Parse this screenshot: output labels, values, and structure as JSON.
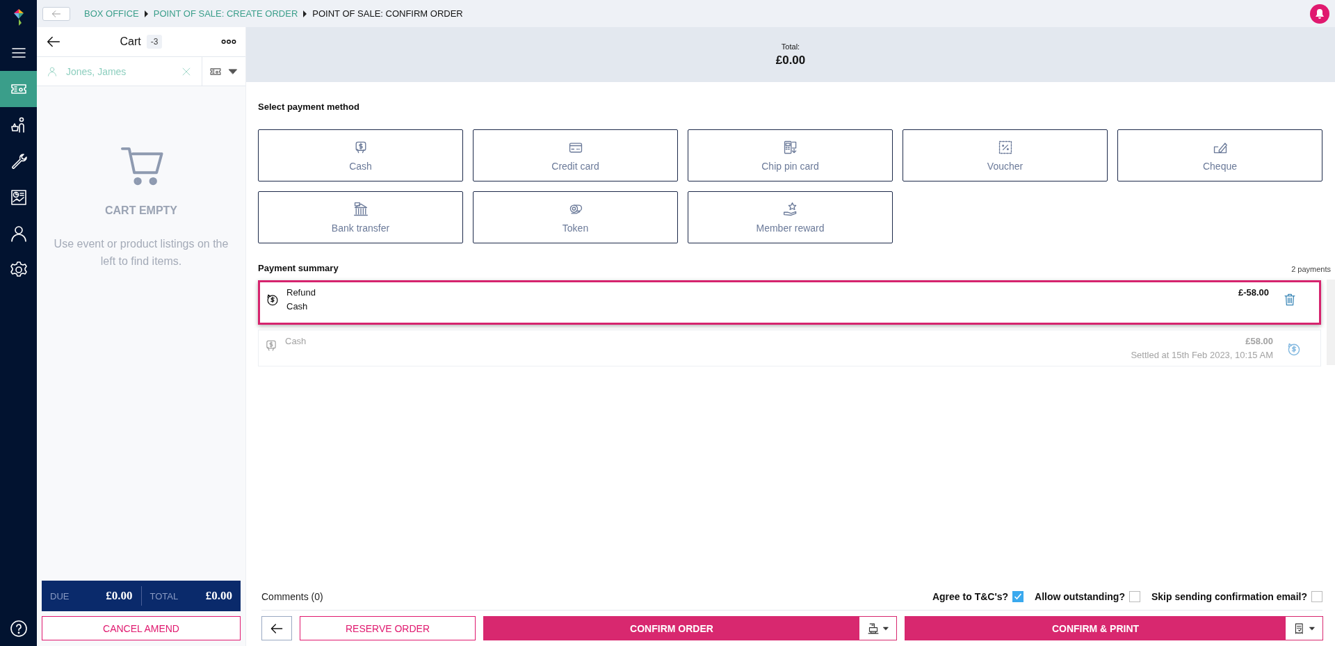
{
  "nav": {
    "items": [
      {
        "kind": "menu",
        "selected": false
      },
      {
        "kind": "ticket",
        "selected": true
      },
      {
        "kind": "basket",
        "selected": false
      },
      {
        "kind": "wrench",
        "selected": false
      },
      {
        "kind": "report",
        "selected": false
      },
      {
        "kind": "person",
        "selected": false
      },
      {
        "kind": "gear",
        "selected": false
      }
    ]
  },
  "breadcrumb": {
    "items": [
      {
        "label": "BOX OFFICE",
        "current": false
      },
      {
        "label": "POINT OF SALE: CREATE ORDER",
        "current": false
      },
      {
        "label": "POINT OF SALE: CONFIRM ORDER",
        "current": true
      }
    ]
  },
  "cart": {
    "title": "Cart",
    "count": "-3",
    "customer": "Jones, James",
    "empty_title": "CART EMPTY",
    "empty_text": "Use event or product listings on the left to find items.",
    "due_label": "DUE",
    "due_value": "£0.00",
    "total_label": "TOTAL",
    "total_value": "£0.00",
    "cancel_button": "CANCEL AMEND"
  },
  "total": {
    "label": "Total:",
    "value": "£0.00"
  },
  "payment_methods": {
    "heading": "Select payment method",
    "items": [
      {
        "label": "Cash",
        "kind": "cash"
      },
      {
        "label": "Credit card",
        "kind": "card"
      },
      {
        "label": "Chip pin card",
        "kind": "chip"
      },
      {
        "label": "Voucher",
        "kind": "voucher"
      },
      {
        "label": "Cheque",
        "kind": "cheque"
      },
      {
        "label": "Bank transfer",
        "kind": "bank"
      },
      {
        "label": "Token",
        "kind": "token"
      },
      {
        "label": "Member reward",
        "kind": "reward"
      }
    ]
  },
  "payment_summary": {
    "heading": "Payment summary",
    "count": "2 payments",
    "payments": [
      {
        "kind": "refund",
        "selected": true,
        "title": "Refund",
        "method": "Cash",
        "amount": "£-58.00"
      },
      {
        "kind": "payment",
        "selected": false,
        "method": "Cash",
        "amount": "£58.00",
        "settled": "Settled at 15th Feb 2023, 10:15 AM"
      }
    ]
  },
  "footer": {
    "comments": "Comments (0)",
    "options": [
      {
        "label": "Agree to T&C's?",
        "checked": true
      },
      {
        "label": "Allow outstanding?",
        "checked": false
      },
      {
        "label": "Skip sending confirmation email?",
        "checked": false
      }
    ],
    "reserve_button": "RESERVE ORDER",
    "confirm_button": "CONFIRM ORDER",
    "print_button": "CONFIRM & PRINT"
  }
}
